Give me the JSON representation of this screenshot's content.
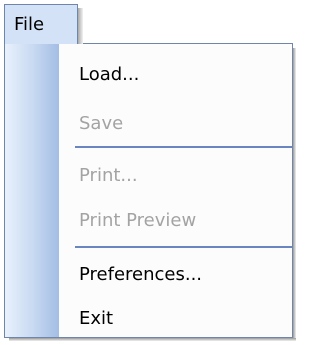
{
  "menubar": {
    "file_menu": {
      "label": "File"
    }
  },
  "file_menu": {
    "items": [
      {
        "label": "Load...",
        "enabled": true
      },
      {
        "label": "Save",
        "enabled": false
      },
      {
        "label": "Print...",
        "enabled": false
      },
      {
        "label": "Print Preview",
        "enabled": false
      },
      {
        "label": "Preferences...",
        "enabled": true
      },
      {
        "label": "Exit",
        "enabled": true
      }
    ],
    "separator_after": [
      "Save",
      "Print Preview"
    ]
  },
  "colors": {
    "menu_tab_bg": "#d4e2f7",
    "border": "#6f86a8",
    "separator": "#6a86c0",
    "disabled_text": "#a4a3a3",
    "gutter_light": "#e9f1fc",
    "gutter_dark": "#a3bde4"
  }
}
